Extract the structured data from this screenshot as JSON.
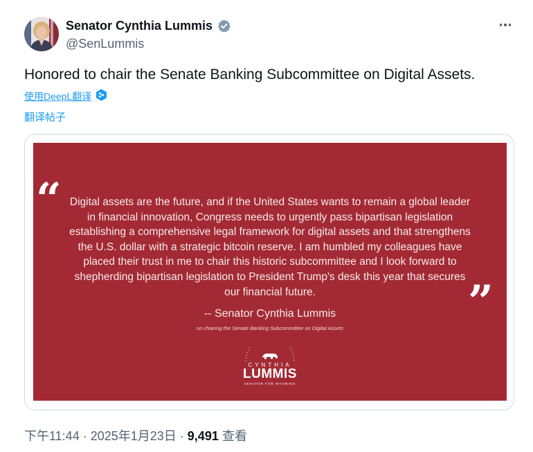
{
  "author": {
    "display_name": "Senator Cynthia Lummis",
    "handle": "@SenLummis",
    "verified": "verified-badge"
  },
  "tweet": {
    "text": "Honored to chair the Senate Banking Subcommittee on Digital Assets."
  },
  "translation": {
    "deepl_label": "使用DeepL翻译",
    "translate_label": "翻译帖子"
  },
  "media": {
    "quote_open": "“",
    "quote_close": "”",
    "quote": "Digital assets are the future, and if the United States wants to remain a global leader in financial innovation, Congress needs to urgently pass bipartisan legislation establishing a comprehensive legal framework for digital assets and that strengthens the U.S. dollar with a strategic bitcoin reserve. I am humbled my colleagues have placed their trust in me to chair this historic subcommittee and I look forward to shepherding bipartisan legislation to President Trump's desk this year that secures our financial future.",
    "attribution": "-- Senator Cynthia Lummis",
    "attribution_sub": "on chairing the Senate Banking Subcommittee on Digital Assets",
    "logo_first": "CYNTHIA",
    "logo_last": "LUMMIS",
    "logo_tagline": "SENATOR FOR WYOMING",
    "background_color": "#a32a35"
  },
  "meta": {
    "time": "下午11:44",
    "separator1": " · ",
    "date": "2025年1月23日",
    "separator2": " · ",
    "views_count": "9,491",
    "views_label": " 查看"
  },
  "colors": {
    "link": "#1d9bf0",
    "secondary_text": "#536471",
    "primary_text": "#0f1419",
    "verified": "#829aab"
  }
}
